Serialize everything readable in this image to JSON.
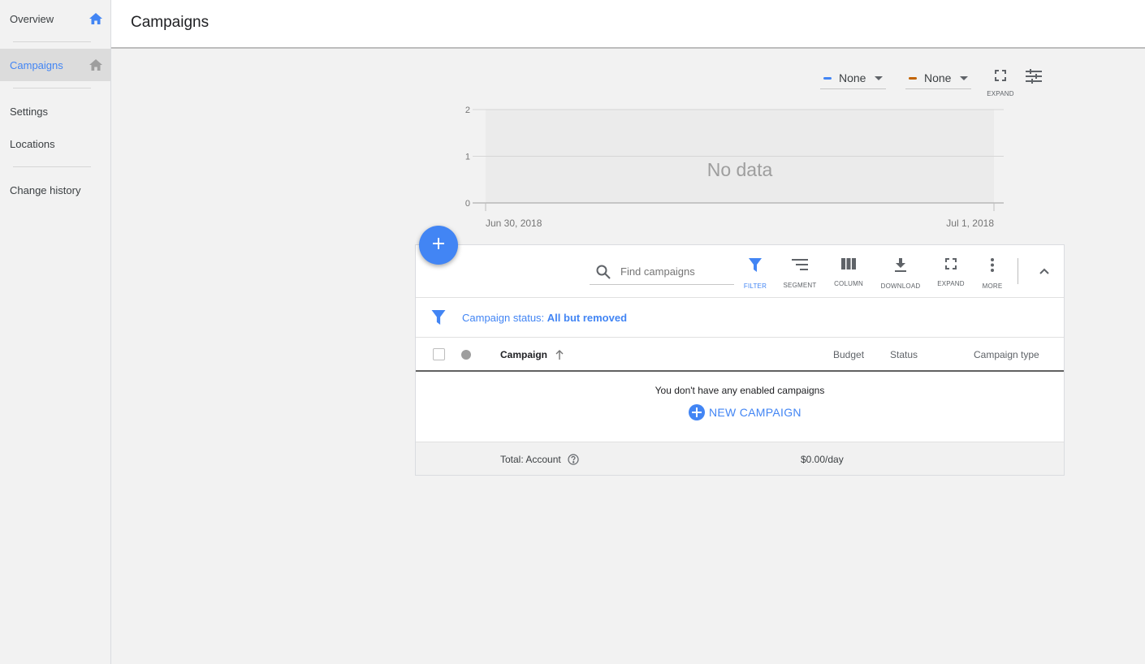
{
  "sidebar": {
    "items": [
      {
        "label": "Overview",
        "icon": "home-icon"
      },
      {
        "label": "Campaigns",
        "icon": "home-icon"
      },
      {
        "label": "Settings"
      },
      {
        "label": "Locations"
      },
      {
        "label": "Change history"
      }
    ]
  },
  "header": {
    "title": "Campaigns"
  },
  "chart_controls": {
    "metric_1": "None",
    "metric_1_color": "#4285f4",
    "metric_2": "None",
    "metric_2_color": "#c26401",
    "expand_label": "EXPAND"
  },
  "chart_data": {
    "type": "line",
    "x": [
      "Jun 30, 2018",
      "Jul 1, 2018"
    ],
    "series": [],
    "yticks": [
      "2",
      "1",
      "0"
    ],
    "ylim": [
      0,
      2
    ],
    "empty_message": "No data"
  },
  "toolbar": {
    "search_placeholder": "Find campaigns",
    "filter": "FILTER",
    "segment": "SEGMENT",
    "column": "COLUMN",
    "download": "DOWNLOAD",
    "expand": "EXPAND",
    "more": "MORE"
  },
  "filter": {
    "prefix": "Campaign status: ",
    "value": "All but removed"
  },
  "table": {
    "columns": {
      "campaign": "Campaign",
      "budget": "Budget",
      "status": "Status",
      "type": "Campaign type"
    },
    "empty_message": "You don't have any enabled campaigns",
    "new_campaign": "NEW CAMPAIGN",
    "footer": {
      "total_label": "Total: Account",
      "budget": "$0.00/day"
    }
  },
  "colors": {
    "accent": "#4285f4"
  }
}
